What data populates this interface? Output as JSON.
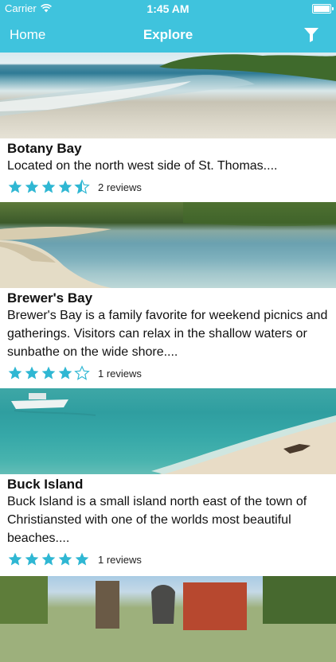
{
  "status_bar": {
    "carrier": "Carrier",
    "time": "1:45 AM"
  },
  "nav": {
    "home_label": "Home",
    "title": "Explore",
    "filter_icon": "filter-icon"
  },
  "colors": {
    "accent": "#3fc3dd",
    "star": "#2fb7d3"
  },
  "places": [
    {
      "name": "Botany Bay",
      "description": "Located on the north west side of St. Thomas....",
      "rating": 4.5,
      "reviews": "2 reviews"
    },
    {
      "name": "Brewer's Bay",
      "description": "Brewer's Bay is a family favorite for weekend picnics and gatherings. Visitors can relax in the shallow waters or sunbathe on the wide shore....",
      "rating": 4,
      "reviews": "1 reviews"
    },
    {
      "name": "Buck Island",
      "description": "Buck Island is a small island north east of the town of Christiansted with one  of the worlds most beautiful beaches....",
      "rating": 5,
      "reviews": "1 reviews"
    }
  ]
}
